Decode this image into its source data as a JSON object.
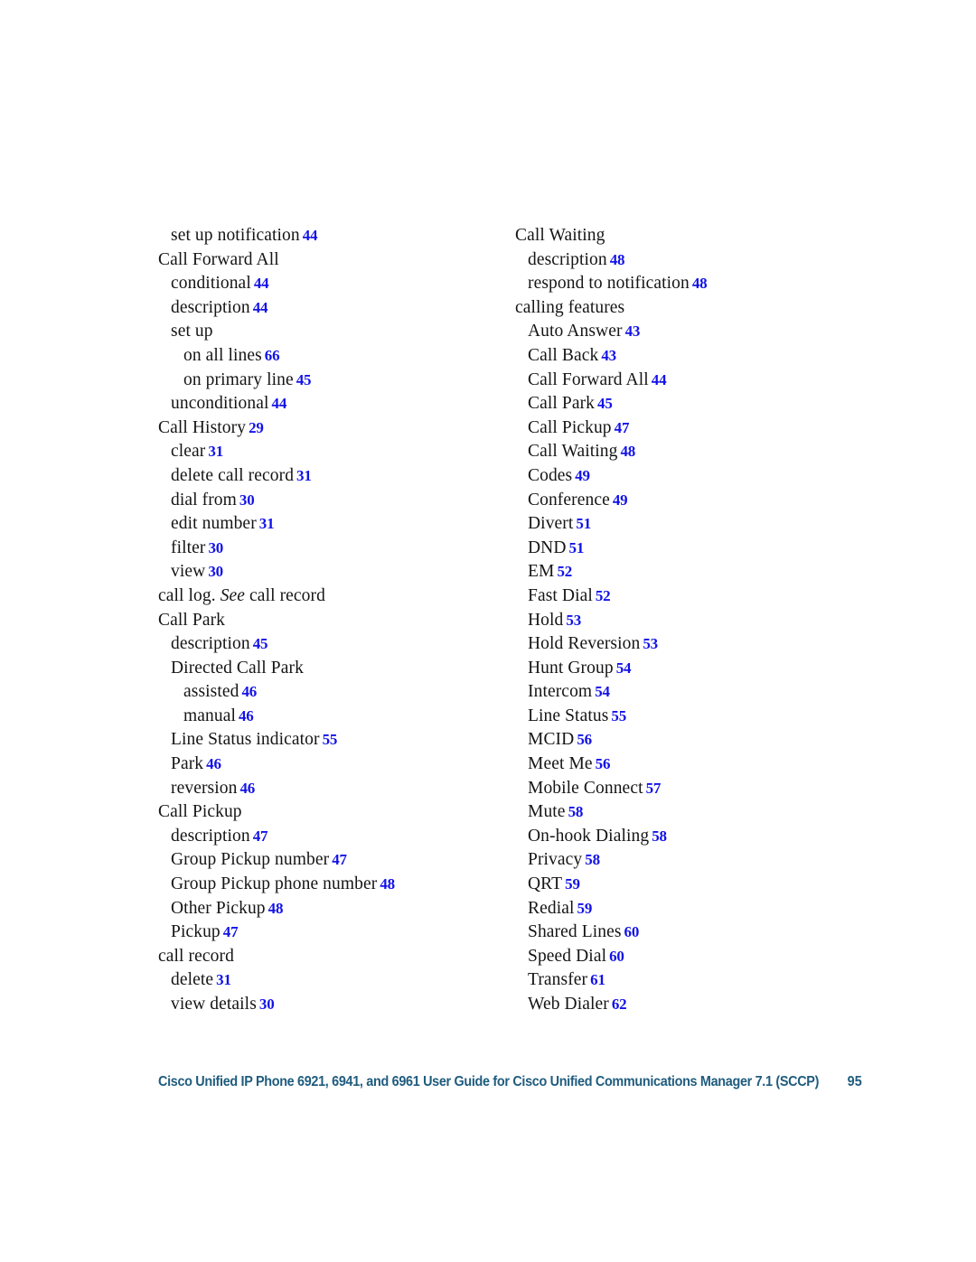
{
  "document": {
    "type": "index",
    "page_number": "95",
    "footer_title": "Cisco Unified IP Phone 6921, 6941, and 6961 User Guide for Cisco Unified Communications Manager 7.1 (SCCP)",
    "footer_color": "#1F5C7E",
    "page_ref_color": "#1212E8",
    "background_color": "#FFFFFF",
    "text_color": "#151515"
  },
  "columns": [
    {
      "name": "left-column",
      "entries": [
        {
          "level": 1,
          "text": "set up notification",
          "page": "44"
        },
        {
          "level": 0,
          "text": "Call Forward All",
          "page": ""
        },
        {
          "level": 1,
          "text": "conditional",
          "page": "44"
        },
        {
          "level": 1,
          "text": "description",
          "page": "44"
        },
        {
          "level": 1,
          "text": "set up",
          "page": ""
        },
        {
          "level": 2,
          "text": "on all lines",
          "page": "66"
        },
        {
          "level": 2,
          "text": "on primary line",
          "page": "45"
        },
        {
          "level": 1,
          "text": "unconditional",
          "page": "44"
        },
        {
          "level": 0,
          "text": "Call History",
          "page": "29"
        },
        {
          "level": 1,
          "text": "clear",
          "page": "31"
        },
        {
          "level": 1,
          "text": "delete call record",
          "page": "31"
        },
        {
          "level": 1,
          "text": "dial from",
          "page": "30"
        },
        {
          "level": 1,
          "text": "edit number",
          "page": "31"
        },
        {
          "level": 1,
          "text": "filter",
          "page": "30"
        },
        {
          "level": 1,
          "text": "view",
          "page": "30"
        },
        {
          "level": 0,
          "text": "call log. See call record",
          "page": "",
          "italic_word": "See"
        },
        {
          "level": 0,
          "text": "Call Park",
          "page": ""
        },
        {
          "level": 1,
          "text": "description",
          "page": "45"
        },
        {
          "level": 1,
          "text": "Directed Call Park",
          "page": ""
        },
        {
          "level": 2,
          "text": "assisted",
          "page": "46"
        },
        {
          "level": 2,
          "text": "manual",
          "page": "46"
        },
        {
          "level": 1,
          "text": "Line Status indicator",
          "page": "55"
        },
        {
          "level": 1,
          "text": "Park",
          "page": "46"
        },
        {
          "level": 1,
          "text": "reversion",
          "page": "46"
        },
        {
          "level": 0,
          "text": "Call Pickup",
          "page": ""
        },
        {
          "level": 1,
          "text": "description",
          "page": "47"
        },
        {
          "level": 1,
          "text": "Group Pickup number",
          "page": "47"
        },
        {
          "level": 1,
          "text": "Group Pickup phone number",
          "page": "48"
        },
        {
          "level": 1,
          "text": "Other Pickup",
          "page": "48"
        },
        {
          "level": 1,
          "text": "Pickup",
          "page": "47"
        },
        {
          "level": 0,
          "text": "call record",
          "page": ""
        },
        {
          "level": 1,
          "text": "delete",
          "page": "31"
        },
        {
          "level": 1,
          "text": "view details",
          "page": "30"
        }
      ]
    },
    {
      "name": "right-column",
      "entries": [
        {
          "level": 0,
          "text": "Call Waiting",
          "page": ""
        },
        {
          "level": 1,
          "text": "description",
          "page": "48"
        },
        {
          "level": 1,
          "text": "respond to notification",
          "page": "48"
        },
        {
          "level": 0,
          "text": "calling features",
          "page": ""
        },
        {
          "level": 1,
          "text": "Auto Answer",
          "page": "43"
        },
        {
          "level": 1,
          "text": "Call Back",
          "page": "43"
        },
        {
          "level": 1,
          "text": "Call Forward All",
          "page": "44"
        },
        {
          "level": 1,
          "text": "Call Park",
          "page": "45"
        },
        {
          "level": 1,
          "text": "Call Pickup",
          "page": "47"
        },
        {
          "level": 1,
          "text": "Call Waiting",
          "page": "48"
        },
        {
          "level": 1,
          "text": "Codes",
          "page": "49"
        },
        {
          "level": 1,
          "text": "Conference",
          "page": "49"
        },
        {
          "level": 1,
          "text": "Divert",
          "page": "51"
        },
        {
          "level": 1,
          "text": "DND",
          "page": "51"
        },
        {
          "level": 1,
          "text": "EM",
          "page": "52"
        },
        {
          "level": 1,
          "text": "Fast Dial",
          "page": "52"
        },
        {
          "level": 1,
          "text": "Hold",
          "page": "53"
        },
        {
          "level": 1,
          "text": "Hold Reversion",
          "page": "53"
        },
        {
          "level": 1,
          "text": "Hunt Group",
          "page": "54"
        },
        {
          "level": 1,
          "text": "Intercom",
          "page": "54"
        },
        {
          "level": 1,
          "text": "Line Status",
          "page": "55"
        },
        {
          "level": 1,
          "text": "MCID",
          "page": "56"
        },
        {
          "level": 1,
          "text": "Meet Me",
          "page": "56"
        },
        {
          "level": 1,
          "text": "Mobile Connect",
          "page": "57"
        },
        {
          "level": 1,
          "text": "Mute",
          "page": "58"
        },
        {
          "level": 1,
          "text": "On-hook Dialing",
          "page": "58"
        },
        {
          "level": 1,
          "text": "Privacy",
          "page": "58"
        },
        {
          "level": 1,
          "text": "QRT",
          "page": "59"
        },
        {
          "level": 1,
          "text": "Redial",
          "page": "59"
        },
        {
          "level": 1,
          "text": "Shared Lines",
          "page": "60"
        },
        {
          "level": 1,
          "text": "Speed Dial",
          "page": "60"
        },
        {
          "level": 1,
          "text": "Transfer",
          "page": "61"
        },
        {
          "level": 1,
          "text": "Web Dialer",
          "page": "62"
        }
      ]
    }
  ]
}
